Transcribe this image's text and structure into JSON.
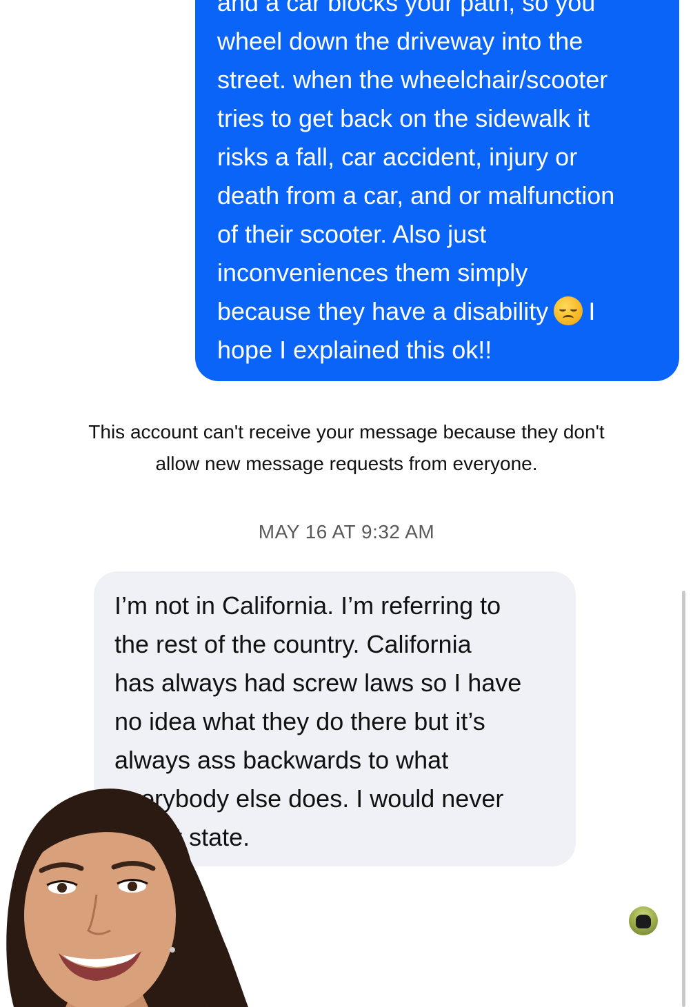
{
  "sent_message": {
    "lines": [
      "and a car blocks your path, so you",
      "wheel down the driveway into the",
      "street. when the wheelchair/scooter",
      "tries to get back on the sidewalk it",
      "risks a fall, car accident, injury or",
      "death from a car, and or malfunction",
      "of their scooter. Also just",
      "inconveniences them simply",
      "because they have a disability",
      "hope I explained this ok!!"
    ],
    "emoji_after_line_9": "disappointed-face",
    "line_9_suffix": "I",
    "bubble_color": "#0a64f8"
  },
  "delivery_notice": {
    "line1": "This account can't receive your message because they don't",
    "line2": "allow new message requests from everyone."
  },
  "timestamp": "MAY 16 AT 9:32 AM",
  "received_message": {
    "lines": [
      "I’m not in California. I’m referring to",
      "the rest of the country. California",
      "has always had screw laws so I have",
      "no idea what they do there but it’s",
      "always ass backwards to what",
      "everybody else does. I would never",
      "in that state."
    ],
    "bubble_color": "#eff1f7"
  },
  "avatar": {
    "icon": "animal-profile-avatar"
  }
}
